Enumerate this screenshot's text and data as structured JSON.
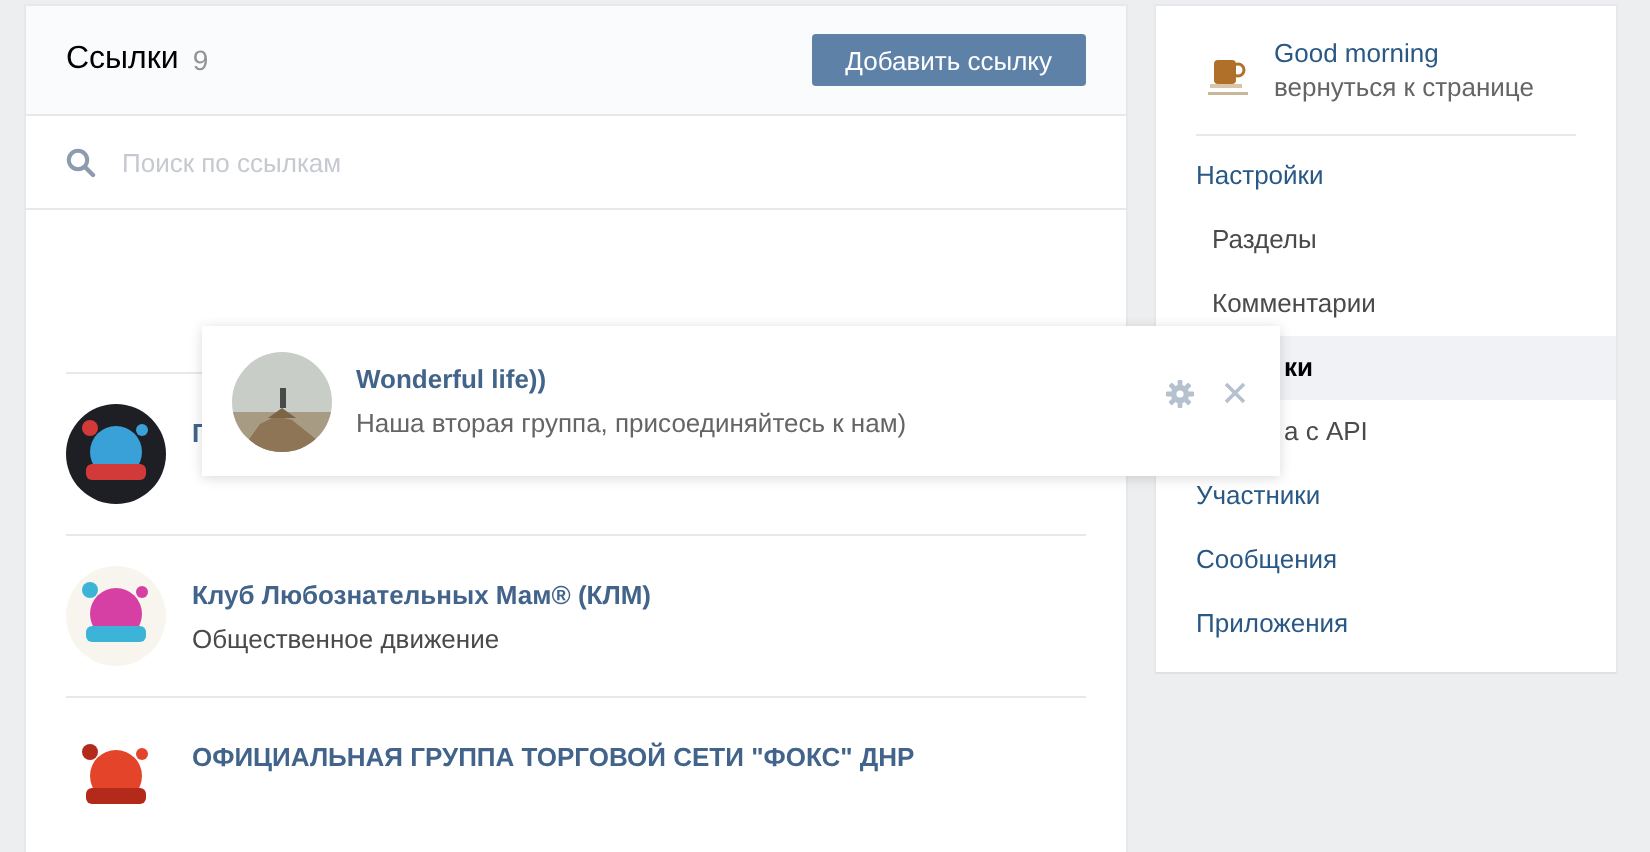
{
  "header": {
    "title": "Ссылки",
    "count": "9",
    "add_button": "Добавить ссылку"
  },
  "search": {
    "placeholder": "Поиск по ссылкам"
  },
  "links": [
    {
      "title": "Г"
    },
    {
      "title": "Клуб Любознательных Мам® (КЛМ)",
      "subtitle": "Общественное движение"
    },
    {
      "title": "ОФИЦИАЛЬНАЯ ГРУППА ТОРГОВОЙ СЕТИ \"ФОКС\" ДНР"
    }
  ],
  "dragged_link": {
    "title": "Wonderful life))",
    "subtitle": "Наша вторая группа, присоединяйтесь к нам)"
  },
  "sidebar": {
    "group": {
      "name": "Good morning",
      "link": "вернуться к странице"
    },
    "menu": [
      {
        "label": "Настройки",
        "selected": false,
        "kind": "plain",
        "children": [
          {
            "label": "Разделы",
            "selected": false,
            "kind": "plain"
          },
          {
            "label": "Комментарии",
            "selected": false,
            "kind": "plain"
          },
          {
            "label": "ки",
            "selected": true,
            "kind": "covered"
          },
          {
            "label": "а с API",
            "selected": false,
            "kind": "covered"
          }
        ]
      },
      {
        "label": "Участники",
        "selected": false,
        "kind": "plain"
      },
      {
        "label": "Сообщения",
        "selected": false,
        "kind": "plain"
      },
      {
        "label": "Приложения",
        "selected": false,
        "kind": "plain"
      }
    ]
  }
}
